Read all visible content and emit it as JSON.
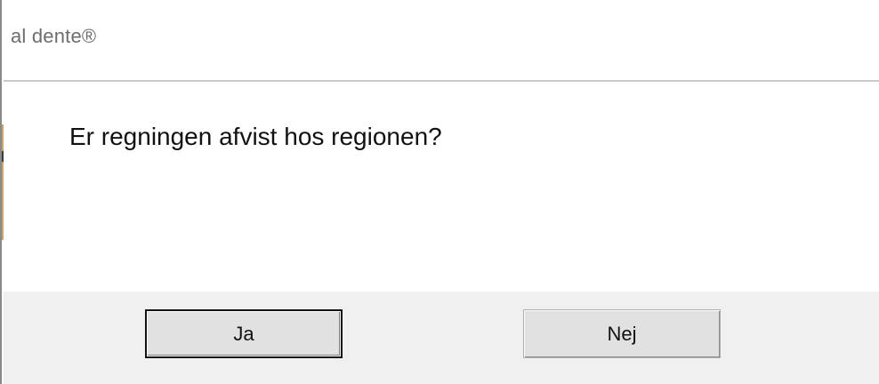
{
  "window": {
    "title": "al dente®"
  },
  "message": {
    "text": "Er regningen afvist hos regionen?"
  },
  "buttons": {
    "yes_label": "Ja",
    "no_label": "Nej"
  }
}
